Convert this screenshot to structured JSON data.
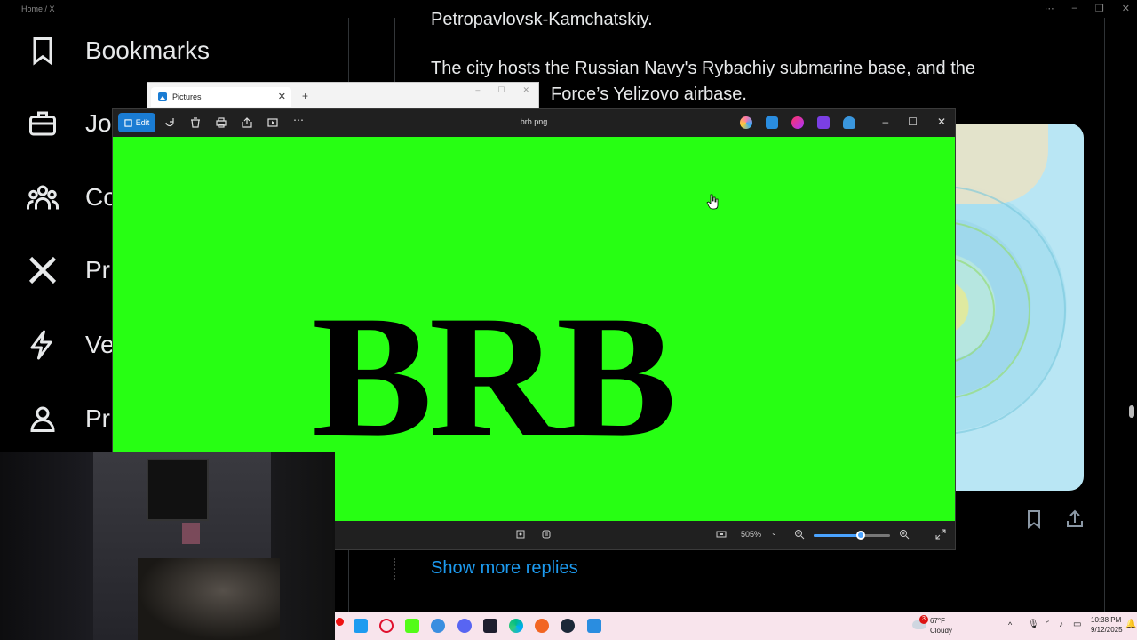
{
  "browser": {
    "breadcrumb": "Home / X",
    "nav": [
      {
        "label": "Bookmarks",
        "icon": "bookmark-icon"
      },
      {
        "label": "Jo",
        "icon": "briefcase-icon"
      },
      {
        "label": "Co",
        "icon": "communities-icon"
      },
      {
        "label": "Pr",
        "icon": "x-logo-icon"
      },
      {
        "label": "Ve",
        "icon": "lightning-icon"
      },
      {
        "label": "Pr",
        "icon": "profile-icon"
      }
    ],
    "tweet_line1": "Petropavlovsk-Kamchatskiy.",
    "tweet_line2": "The city hosts the Russian Navy's Rybachiy submarine base, and the",
    "tweet_line3": "Force’s Yelizovo airbase.",
    "show_more": "Show more replies"
  },
  "pictures_window": {
    "tab_label": "Pictures"
  },
  "viewer": {
    "edit_label": "Edit",
    "title": "brb.png",
    "image_text": "BRB",
    "image_bg": "#27ff13",
    "zoom_label": "505%",
    "zoom_level": 0.62
  },
  "taskbar": {
    "weather_temp": "67°F",
    "weather_desc": "Cloudy",
    "weather_badge": "3",
    "time": "10:38 PM",
    "date": "9/12/2025"
  },
  "colors": {
    "accent": "#1d9bf0",
    "edit_button": "#1a7cd3",
    "taskbar": "#f8e4ec"
  }
}
